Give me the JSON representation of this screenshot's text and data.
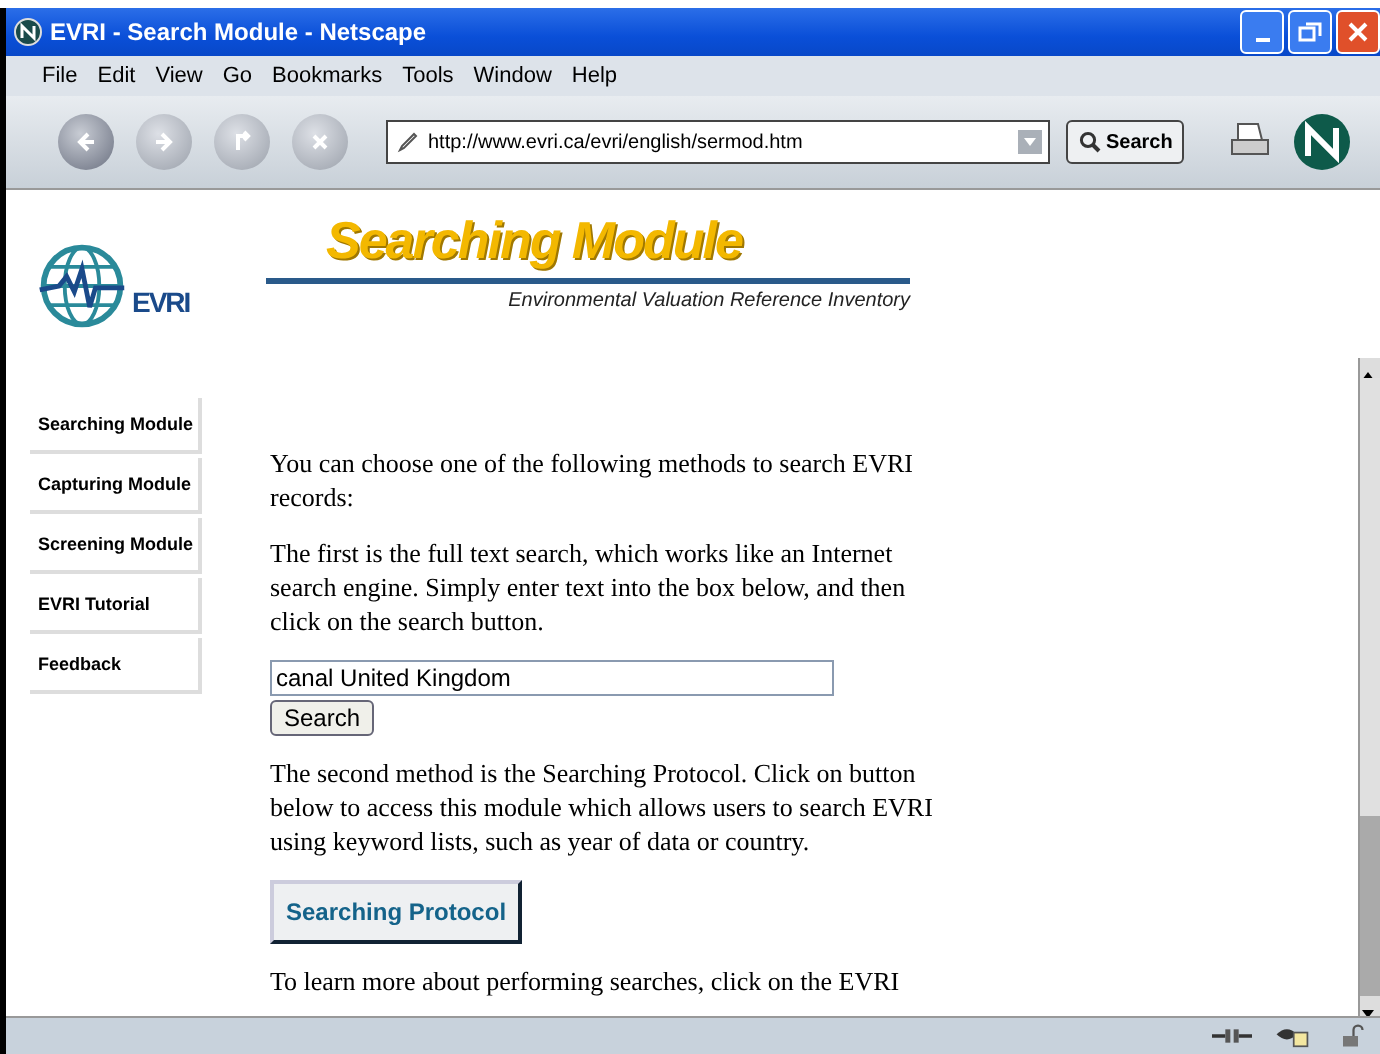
{
  "window": {
    "title": "EVRI - Search Module - Netscape"
  },
  "menu": [
    "File",
    "Edit",
    "View",
    "Go",
    "Bookmarks",
    "Tools",
    "Window",
    "Help"
  ],
  "toolbar": {
    "url": "http://www.evri.ca/evri/english/sermod.htm",
    "search_label": "Search"
  },
  "header": {
    "logo_text": "EVRI",
    "title": "Searching Module",
    "subtitle": "Environmental Valuation Reference Inventory"
  },
  "nav": [
    "Searching Module",
    "Capturing Module",
    "Screening Module",
    "EVRI Tutorial",
    "Feedback"
  ],
  "content": [
    {
      "kind": "text",
      "text": "You can choose one of the following methods to search EVRI records:"
    },
    {
      "kind": "text",
      "text": "The first is the full text search, which works like an Internet search engine. Simply enter text into the box below, and then click on the search button."
    },
    {
      "kind": "search",
      "value": "canal United Kingdom",
      "button": "Search"
    },
    {
      "kind": "text",
      "text": "The second method is the Searching Protocol. Click on button below to access this module which allows users to search EVRI using keyword lists, such as year of data or country."
    },
    {
      "kind": "bigbutton",
      "label": "Searching Protocol"
    },
    {
      "kind": "text",
      "text": "To learn more about performing searches, click on the EVRI"
    }
  ]
}
